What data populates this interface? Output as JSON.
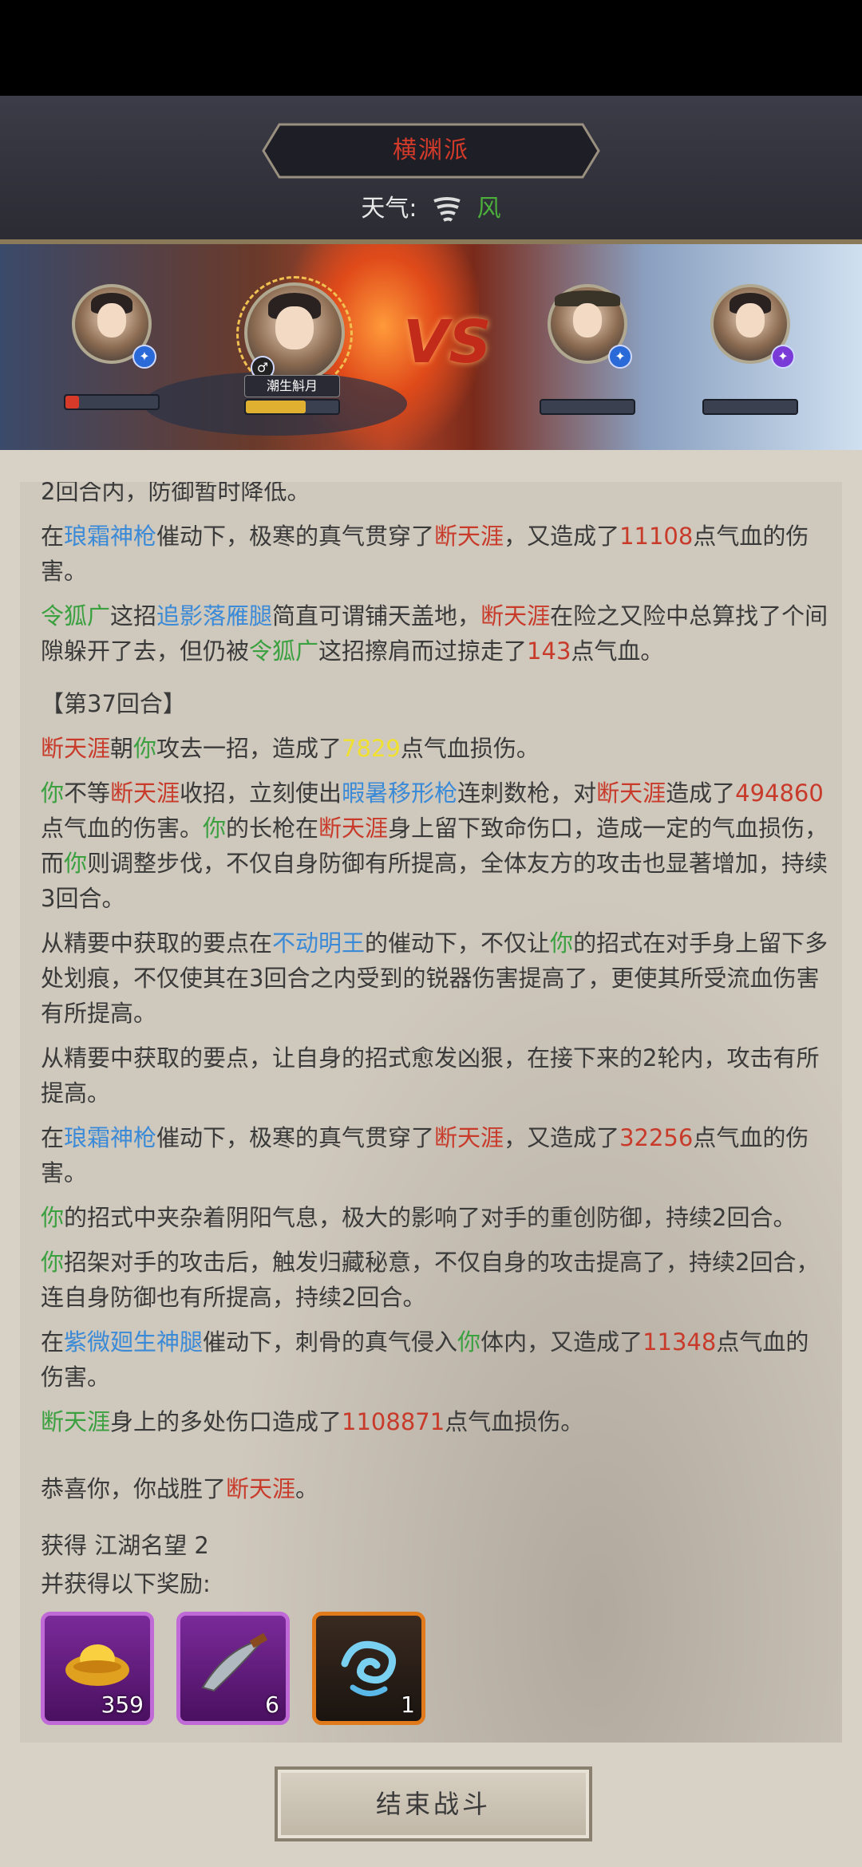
{
  "header": {
    "title": "横渊派",
    "weather_label": "天气:",
    "weather_value": "风",
    "weather_icon": "whirlwind-icon"
  },
  "battle": {
    "vs_text": "VS",
    "active_name": "潮生斛月",
    "allies": [
      {
        "hp": 0.15,
        "hp_color": "#d83a2a"
      },
      {
        "hp": 0.65,
        "hp_color": "#e0b030"
      }
    ],
    "enemies": [
      {
        "hp": 0.0
      },
      {
        "hp": 0.0
      }
    ]
  },
  "log": {
    "p0_a": "2回合内，防御暂时降低。",
    "p1": {
      "a": "在",
      "b": "琅霜神枪",
      "c": "催动下，极寒的真气贯穿了",
      "d": "断天涯",
      "e": "，又造成了",
      "f": "11108",
      "g": "点气血的伤害。"
    },
    "p2": {
      "a": "令狐广",
      "b": "这招",
      "c": "追影落雁腿",
      "d": "简直可谓铺天盖地，",
      "e": "断天涯",
      "f": "在险之又险中总算找了个间隙躲开了去，但仍被",
      "g": "令狐广",
      "h": "这招擦肩而过掠走了",
      "i": "143",
      "j": "点气血。"
    },
    "round": "【第37回合】",
    "p3": {
      "a": "断天涯",
      "b": "朝",
      "c": "你",
      "d": "攻去一招，造成了",
      "e": "7829",
      "f": "点气血损伤。"
    },
    "p4": {
      "a": "你",
      "b": "不等",
      "c": "断天涯",
      "d": "收招，立刻使出",
      "e": "暇暑移形枪",
      "f": "连刺数枪，对",
      "g": "断天涯",
      "h": "造成了",
      "i": "494860",
      "j": "点气血的伤害。",
      "k": "你",
      "l": "的长枪在",
      "m": "断天涯",
      "n": "身上留下致命伤口，造成一定的气血损伤，而",
      "o": "你",
      "p": "则调整步伐，不仅自身防御有所提高，全体友方的攻击也显著增加，持续3回合。"
    },
    "p5": {
      "a": "从精要中获取的要点在",
      "b": "不动明王",
      "c": "的催动下，不仅让",
      "d": "你",
      "e": "的招式在对手身上留下多处划痕，不仅使其在3回合之内受到的锐器伤害提高了，更使其所受流血伤害有所提高。"
    },
    "p6": "从精要中获取的要点，让自身的招式愈发凶狠，在接下来的2轮内，攻击有所提高。",
    "p7": {
      "a": "在",
      "b": "琅霜神枪",
      "c": "催动下，极寒的真气贯穿了",
      "d": "断天涯",
      "e": "，又造成了",
      "f": "32256",
      "g": "点气血的伤害。"
    },
    "p8": {
      "a": "你",
      "b": "的招式中夹杂着阴阳气息，极大的影响了对手的重创防御，持续2回合。"
    },
    "p9": {
      "a": "你",
      "b": "招架对手的攻击后，触发归藏秘意，不仅自身的攻击提高了，持续2回合，连自身防御也有所提高，持续2回合。"
    },
    "p10": {
      "a": "在",
      "b": "紫微廻生神腿",
      "c": "催动下，刺骨的真气侵入",
      "d": "你",
      "e": "体内，又造成了",
      "f": "11348",
      "g": "点气血的伤害。"
    },
    "p11": {
      "a": "断天涯",
      "b": "身上的多处伤口造成了",
      "c": "1108871",
      "d": "点气血损伤。"
    },
    "victory": {
      "a": "恭喜你，你战胜了",
      "b": "断天涯",
      "c": "。"
    }
  },
  "rewards": {
    "gain_line": "获得 江湖名望 2",
    "extra_line": "并获得以下奖励:",
    "items": [
      {
        "icon": "gold-ingot-icon",
        "count": "359",
        "rarity": "purple"
      },
      {
        "icon": "dagger-icon",
        "count": "6",
        "rarity": "purple"
      },
      {
        "icon": "cloud-swirl-icon",
        "count": "1",
        "rarity": "orange"
      }
    ]
  },
  "end_button": "结束战斗"
}
